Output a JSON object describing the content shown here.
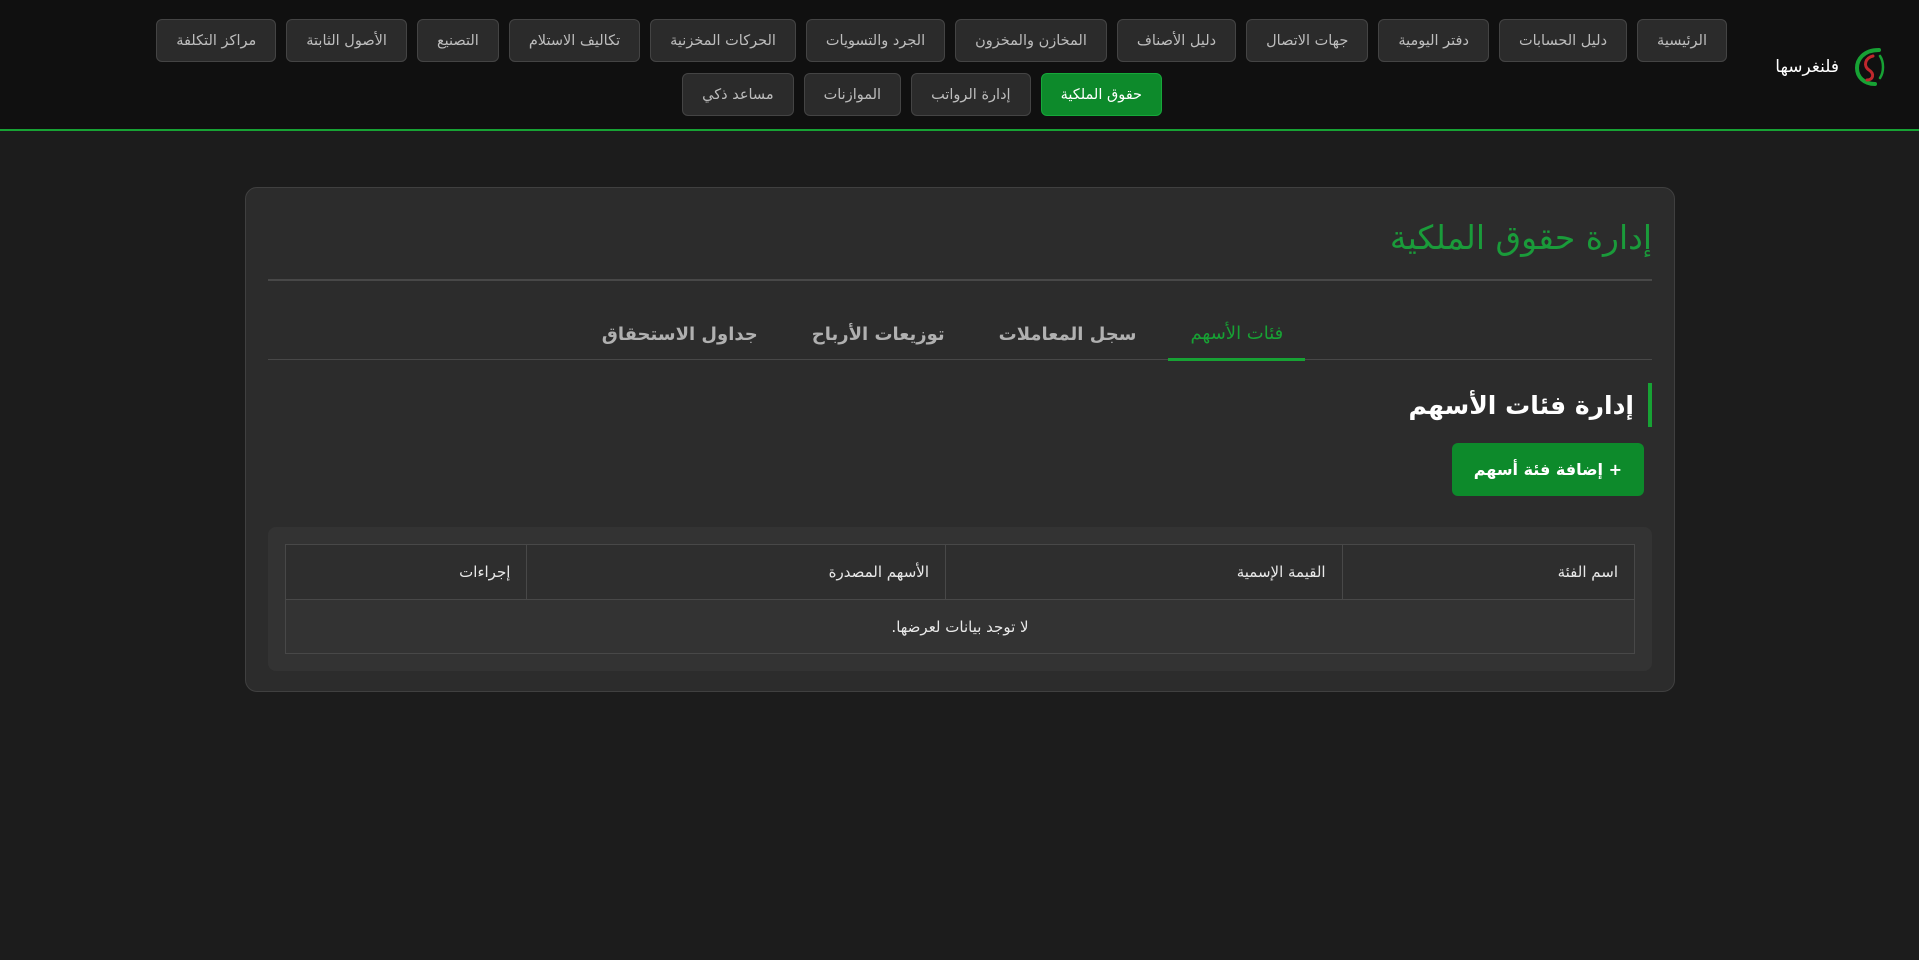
{
  "brand": {
    "name": "فلنغرسها",
    "logo_icon": "leaf-logo-icon"
  },
  "nav": {
    "row1": [
      "الرئيسية",
      "دليل الحسابات",
      "دفتر اليومية",
      "جهات الاتصال",
      "دليل الأصناف",
      "المخازن والمخزون",
      "الجرد والتسويات",
      "الحركات المخزنية",
      "تكاليف الاستلام",
      "التصنيع",
      "الأصول الثابتة",
      "مراكز التكلفة"
    ],
    "row2": [
      "حقوق الملكية",
      "إدارة الرواتب",
      "الموازنات",
      "مساعد ذكي"
    ],
    "active": "حقوق الملكية"
  },
  "page": {
    "title": "إدارة حقوق الملكية",
    "tabs": [
      "فئات الأسهم",
      "سجل المعاملات",
      "توزيعات الأرباح",
      "جداول الاستحقاق"
    ],
    "active_tab": "فئات الأسهم",
    "section_title": "إدارة فئات الأسهم",
    "add_button": "+ إضافة فئة أسهم"
  },
  "table": {
    "columns": [
      "اسم الفئة",
      "القيمة الإسمية",
      "الأسهم المصدرة",
      "إجراءات"
    ],
    "empty_message": "لا توجد بيانات لعرضها."
  },
  "colors": {
    "accent": "#17a234",
    "active_button": "#0d8a2b",
    "background": "#1c1c1c",
    "card": "#2c2c2c"
  }
}
